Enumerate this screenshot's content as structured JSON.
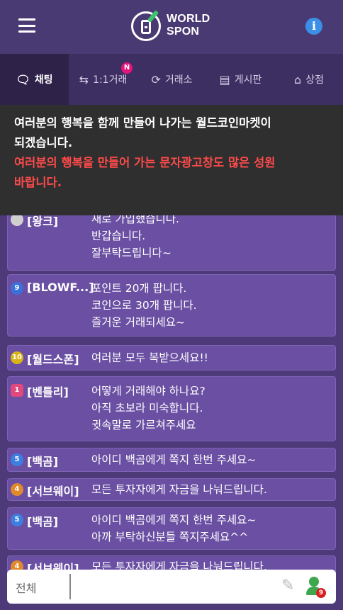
{
  "header": {
    "logo_line1": "WORLD",
    "logo_line2": "SPON",
    "info_glyph": "i"
  },
  "tabs": [
    {
      "label": "채팅",
      "icon": "chat-icon",
      "glyph": "🗨",
      "active": true
    },
    {
      "label": "1:1거래",
      "icon": "swap-icon",
      "glyph": "⇆",
      "badge": "N"
    },
    {
      "label": "거래소",
      "icon": "refresh-icon",
      "glyph": "⟳"
    },
    {
      "label": "게시판",
      "icon": "board-icon",
      "glyph": "▤"
    },
    {
      "label": "상점",
      "icon": "home-icon",
      "glyph": "⌂"
    }
  ],
  "notice": {
    "line1": "여러분의 행복을 함께 만들어 나가는 월드코인마켓이",
    "line2": "되겠습니다.",
    "line3": "여러분의 행복을 만들어 가는 문자광고창도 많은 성원",
    "line4": "바랍니다."
  },
  "messages": [
    {
      "level": "",
      "name": "[왕크]",
      "lines": [
        "새로 가입했습니다.",
        "반갑습니다.",
        "잘부탁드립니다~"
      ]
    },
    {
      "level": "9",
      "name": "[BLOWF...]",
      "lines": [
        "포인트 20개 팝니다.",
        "코인으로 30개 팝니다.",
        "즐거운 거래되세요~"
      ]
    },
    {
      "level": "10",
      "name": "[월드스폰]",
      "lines": [
        "여러분 모두 복받으세요!!"
      ]
    },
    {
      "level": "1",
      "name": "[벤틀리]",
      "lines": [
        "어떻게 거래해야 하나요?",
        "아직 초보라 미숙합니다.",
        "귓속말로 가르쳐주세요"
      ]
    },
    {
      "level": "5",
      "name": "[백곰]",
      "lines": [
        "아이디 백곰에게 쪽지 한번 주세요~"
      ]
    },
    {
      "level": "4",
      "name": "[서브웨이]",
      "lines": [
        "모든 투자자에게 자금을 나눠드립니다."
      ]
    },
    {
      "level": "5",
      "name": "[백곰]",
      "lines": [
        "아이디 백곰에게 쪽지 한번 주세요~",
        "아까 부탁하신분들 쪽지주세요^^"
      ]
    },
    {
      "level": "4",
      "name": "[서브웨이]",
      "lines": [
        "모든 투자자에게 자금을 나눠드립니다."
      ]
    }
  ],
  "input": {
    "scope": "전체",
    "placeholder": "",
    "online_count": "9"
  },
  "colors": {
    "accent": "#e3157a",
    "notice_red": "#ff4a4a",
    "message_bg": "#6a4fa3"
  }
}
